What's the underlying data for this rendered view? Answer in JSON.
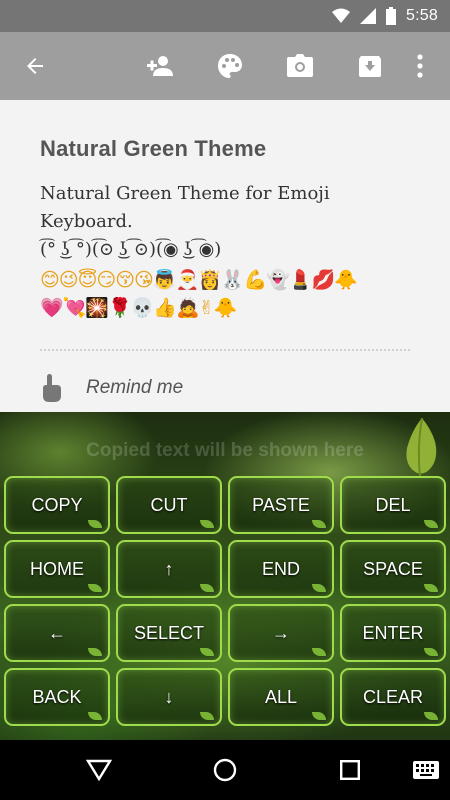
{
  "status_bar": {
    "time": "5:58"
  },
  "note": {
    "title": "Natural Green Theme",
    "body": "Natural Green Theme for Emoji\nKeyboard.\n(͡° ͜ʖ ͡°)(͡⊙ ͜ʖ ͡⊙)(͡◉ ͜ʖ ͡◉)",
    "emoji_line1": "😊😉😇😏😚😘👼🎅👸🐰💪👻💄💋🐥",
    "emoji_line2": "💗💘🎇🌹💀👍🙇✌🐥",
    "remind_label": "Remind me"
  },
  "keyboard": {
    "clipboard_placeholder": "Copied text will be shown here",
    "keys": [
      [
        "COPY",
        "CUT",
        "PASTE",
        "DEL"
      ],
      [
        "HOME",
        "↑",
        "END",
        "SPACE"
      ],
      [
        "←",
        "SELECT",
        "→",
        "ENTER"
      ],
      [
        "BACK",
        "↓",
        "ALL",
        "CLEAR"
      ]
    ]
  },
  "colors": {
    "toolbar": "#9e9e9e",
    "status_bar": "#757575",
    "key_border": "#9fdc4c"
  }
}
